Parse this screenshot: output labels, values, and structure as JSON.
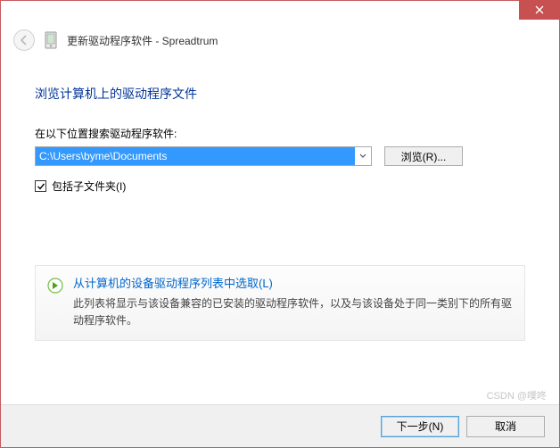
{
  "header": {
    "title": "更新驱动程序软件 - Spreadtrum"
  },
  "main": {
    "heading": "浏览计算机上的驱动程序文件",
    "search_label": "在以下位置搜索驱动程序软件:",
    "path_value": "C:\\Users\\byme\\Documents",
    "browse_label": "浏览(R)...",
    "include_sub_label": "包括子文件夹(I)",
    "option": {
      "title": "从计算机的设备驱动程序列表中选取(L)",
      "desc": "此列表将显示与该设备兼容的已安装的驱动程序软件，以及与该设备处于同一类别下的所有驱动程序软件。"
    }
  },
  "footer": {
    "next": "下一步(N)",
    "cancel": "取消"
  },
  "watermark": "CSDN @噗咚"
}
